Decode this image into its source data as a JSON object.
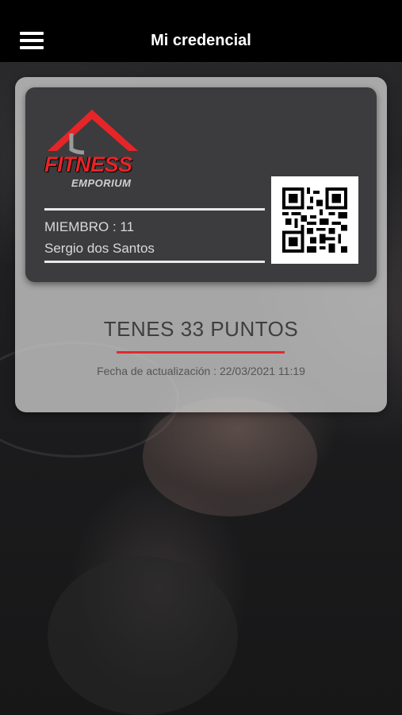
{
  "header": {
    "title": "Mi credencial",
    "menu_icon": "hamburger-menu-icon"
  },
  "card": {
    "logo": {
      "word": "FITNESS",
      "sub": "EMPORIUM",
      "icon": "roof-logo-icon"
    },
    "member_label": "MIEMBRO : 11",
    "member_name": "Sergio dos Santos",
    "qr_icon": "qr-code-icon"
  },
  "points": {
    "text": "TENES 33 PUNTOS",
    "update_text": "Fecha de actualización : 22/03/2021 11:19"
  },
  "colors": {
    "accent_red": "#e02a2f",
    "header_bg": "#000000",
    "card_bg": "#3c3c3e"
  }
}
